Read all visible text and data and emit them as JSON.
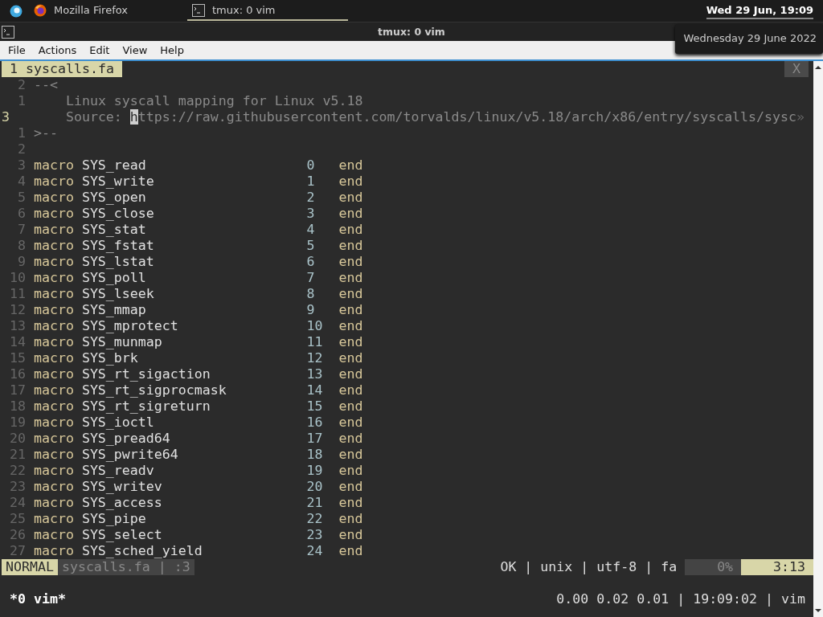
{
  "panel": {
    "tasks": [
      {
        "label": "Mozilla Firefox",
        "kind": "browser",
        "selected": false
      },
      {
        "label": "tmux: 0 vim",
        "kind": "terminal",
        "selected": true
      }
    ],
    "clock": "Wed 29 Jun, 19:09",
    "clock_tooltip": "Wednesday 29 June 2022"
  },
  "window": {
    "title": "tmux: 0 vim"
  },
  "menu": [
    "File",
    "Actions",
    "Edit",
    "View",
    "Help"
  ],
  "vim": {
    "tab": "1 syscalls.fa",
    "close": "X",
    "lines": [
      {
        "number": "2",
        "current": false,
        "kind": "fold",
        "text": "--<"
      },
      {
        "number": "1",
        "current": false,
        "kind": "comment",
        "text": "    Linux syscall mapping for Linux v5.18"
      },
      {
        "number": "3",
        "current": true,
        "kind": "comment",
        "text": "    Source: ",
        "cursor_char": "h",
        "rest": "ttps://raw.githubusercontent.com/torvalds/linux/v5.18/arch/x86/entry/syscalls/sysc",
        "overflow": "»"
      },
      {
        "number": "1",
        "current": false,
        "kind": "fold",
        "text": ">--"
      },
      {
        "number": "2",
        "current": false,
        "kind": "blank"
      },
      {
        "number": "3",
        "current": false,
        "kind": "macro",
        "keyword": "macro",
        "name": "SYS_read",
        "value": "0",
        "end": "end"
      },
      {
        "number": "4",
        "current": false,
        "kind": "macro",
        "keyword": "macro",
        "name": "SYS_write",
        "value": "1",
        "end": "end"
      },
      {
        "number": "5",
        "current": false,
        "kind": "macro",
        "keyword": "macro",
        "name": "SYS_open",
        "value": "2",
        "end": "end"
      },
      {
        "number": "6",
        "current": false,
        "kind": "macro",
        "keyword": "macro",
        "name": "SYS_close",
        "value": "3",
        "end": "end"
      },
      {
        "number": "7",
        "current": false,
        "kind": "macro",
        "keyword": "macro",
        "name": "SYS_stat",
        "value": "4",
        "end": "end"
      },
      {
        "number": "8",
        "current": false,
        "kind": "macro",
        "keyword": "macro",
        "name": "SYS_fstat",
        "value": "5",
        "end": "end"
      },
      {
        "number": "9",
        "current": false,
        "kind": "macro",
        "keyword": "macro",
        "name": "SYS_lstat",
        "value": "6",
        "end": "end"
      },
      {
        "number": "10",
        "current": false,
        "kind": "macro",
        "keyword": "macro",
        "name": "SYS_poll",
        "value": "7",
        "end": "end"
      },
      {
        "number": "11",
        "current": false,
        "kind": "macro",
        "keyword": "macro",
        "name": "SYS_lseek",
        "value": "8",
        "end": "end"
      },
      {
        "number": "12",
        "current": false,
        "kind": "macro",
        "keyword": "macro",
        "name": "SYS_mmap",
        "value": "9",
        "end": "end"
      },
      {
        "number": "13",
        "current": false,
        "kind": "macro",
        "keyword": "macro",
        "name": "SYS_mprotect",
        "value": "10",
        "end": "end"
      },
      {
        "number": "14",
        "current": false,
        "kind": "macro",
        "keyword": "macro",
        "name": "SYS_munmap",
        "value": "11",
        "end": "end"
      },
      {
        "number": "15",
        "current": false,
        "kind": "macro",
        "keyword": "macro",
        "name": "SYS_brk",
        "value": "12",
        "end": "end"
      },
      {
        "number": "16",
        "current": false,
        "kind": "macro",
        "keyword": "macro",
        "name": "SYS_rt_sigaction",
        "value": "13",
        "end": "end"
      },
      {
        "number": "17",
        "current": false,
        "kind": "macro",
        "keyword": "macro",
        "name": "SYS_rt_sigprocmask",
        "value": "14",
        "end": "end"
      },
      {
        "number": "18",
        "current": false,
        "kind": "macro",
        "keyword": "macro",
        "name": "SYS_rt_sigreturn",
        "value": "15",
        "end": "end"
      },
      {
        "number": "19",
        "current": false,
        "kind": "macro",
        "keyword": "macro",
        "name": "SYS_ioctl",
        "value": "16",
        "end": "end"
      },
      {
        "number": "20",
        "current": false,
        "kind": "macro",
        "keyword": "macro",
        "name": "SYS_pread64",
        "value": "17",
        "end": "end"
      },
      {
        "number": "21",
        "current": false,
        "kind": "macro",
        "keyword": "macro",
        "name": "SYS_pwrite64",
        "value": "18",
        "end": "end"
      },
      {
        "number": "22",
        "current": false,
        "kind": "macro",
        "keyword": "macro",
        "name": "SYS_readv",
        "value": "19",
        "end": "end"
      },
      {
        "number": "23",
        "current": false,
        "kind": "macro",
        "keyword": "macro",
        "name": "SYS_writev",
        "value": "20",
        "end": "end"
      },
      {
        "number": "24",
        "current": false,
        "kind": "macro",
        "keyword": "macro",
        "name": "SYS_access",
        "value": "21",
        "end": "end"
      },
      {
        "number": "25",
        "current": false,
        "kind": "macro",
        "keyword": "macro",
        "name": "SYS_pipe",
        "value": "22",
        "end": "end"
      },
      {
        "number": "26",
        "current": false,
        "kind": "macro",
        "keyword": "macro",
        "name": "SYS_select",
        "value": "23",
        "end": "end"
      },
      {
        "number": "27",
        "current": false,
        "kind": "macro",
        "keyword": "macro",
        "name": "SYS_sched_yield",
        "value": "24",
        "end": "end"
      }
    ],
    "status": {
      "mode": "NORMAL",
      "file": "syscalls.fa | :3",
      "info": "OK | unix | utf-8 | fa",
      "percent": "0%",
      "position": "3:13"
    }
  },
  "tmux": {
    "window": "*0 vim*",
    "right": "0.00 0.02 0.01 | 19:09:02 | vim"
  }
}
